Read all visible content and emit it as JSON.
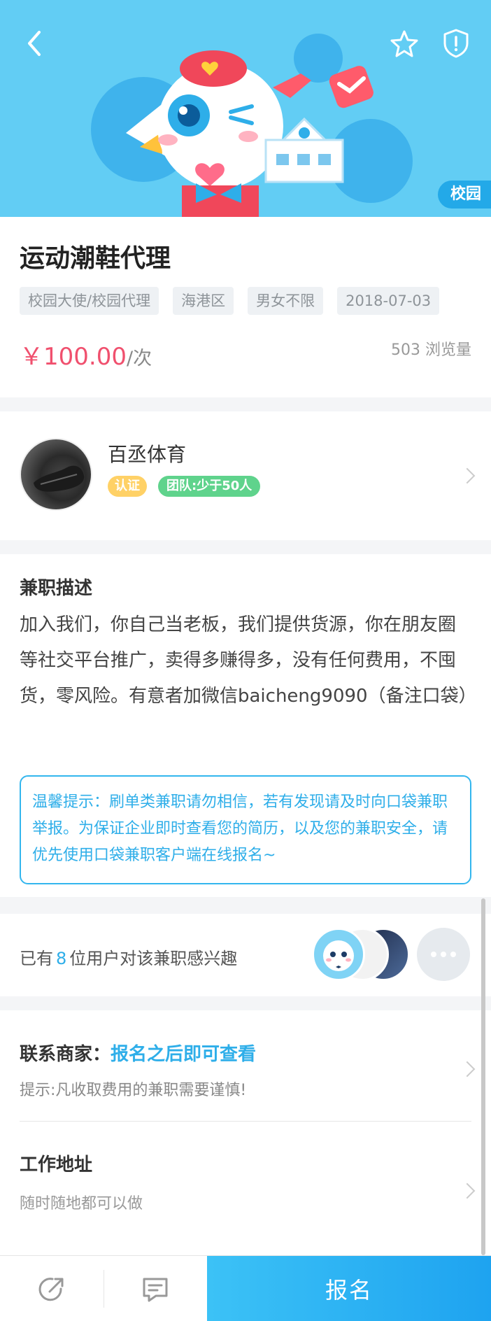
{
  "banner": {
    "tag": "校园"
  },
  "job": {
    "title": "运动潮鞋代理",
    "tags": [
      "校园大使/校园代理",
      "海港区",
      "男女不限",
      "2018-07-03"
    ],
    "price": "￥100.00",
    "price_unit": "/次",
    "views": "503 浏览量"
  },
  "company": {
    "name": "百丞体育",
    "badge_verify": "认证",
    "badge_team": "团队:少于50人"
  },
  "description": {
    "title": "兼职描述",
    "body": "加入我们，你自己当老板，我们提供货源，你在朋友圈等社交平台推广，卖得多赚得多，没有任何费用，不囤货，零风险。有意者加微信baicheng9090（备注口袋）",
    "notice": "温馨提示：刷单类兼职请勿相信，若有发现请及时向口袋兼职举报。为保证企业即时查看您的简历，以及您的兼职安全，请优先使用口袋兼职客户端在线报名~"
  },
  "interest": {
    "prefix": "已有",
    "count": "8",
    "suffix": "位用户对该兼职感兴趣"
  },
  "contact": {
    "label": "联系商家：",
    "value": "报名之后即可查看",
    "hint": "提示:凡收取费用的兼职需要谨慎!"
  },
  "address": {
    "title": "工作地址",
    "value": "随时随地都可以做"
  },
  "bottom": {
    "signup_label": "报名"
  },
  "icons": [
    "back-icon",
    "star-icon",
    "shield-alert-icon",
    "share-icon",
    "message-icon"
  ],
  "colors": {
    "accent": "#2eaee9",
    "price": "#f0506e",
    "banner": "#62cdf4"
  }
}
